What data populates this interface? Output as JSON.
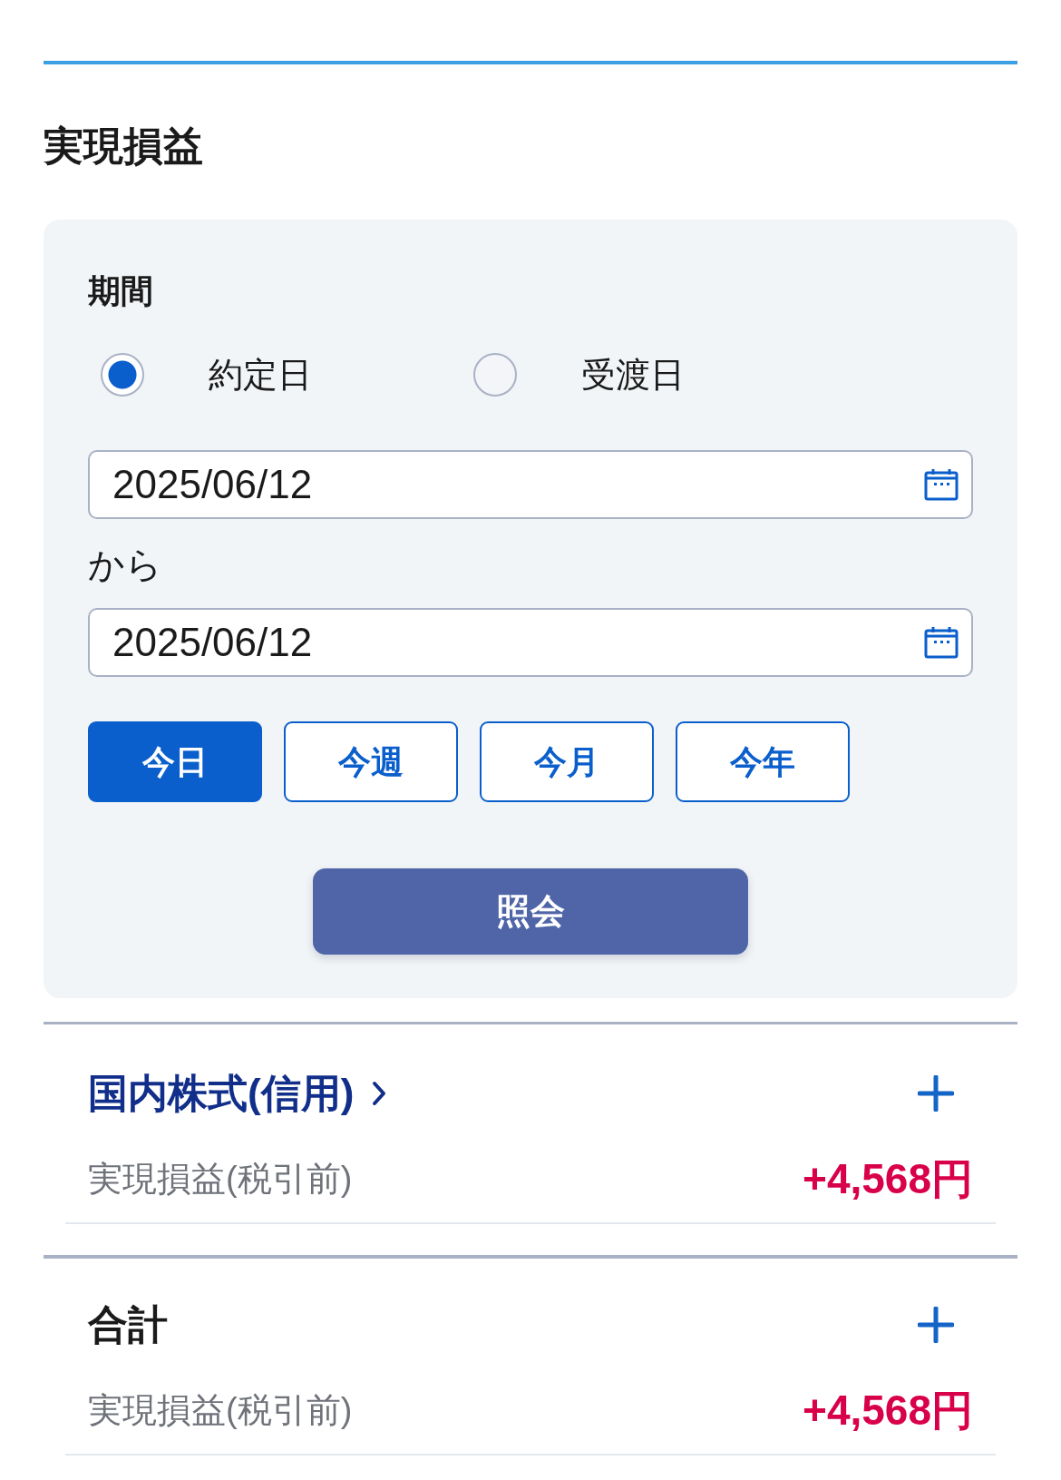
{
  "page": {
    "title": "実現損益"
  },
  "filter": {
    "label": "期間",
    "date_basis": [
      {
        "label": "約定日",
        "selected": true
      },
      {
        "label": "受渡日",
        "selected": false
      }
    ],
    "date_from": {
      "value": "2025/06/12"
    },
    "range_word": "から",
    "date_to": {
      "value": "2025/06/12"
    },
    "presets": [
      {
        "label": "今日",
        "selected": true
      },
      {
        "label": "今週",
        "selected": false
      },
      {
        "label": "今月",
        "selected": false
      },
      {
        "label": "今年",
        "selected": false
      }
    ],
    "submit": "照会"
  },
  "sections": [
    {
      "kind": "link",
      "title": "国内株式(信用)",
      "expanded": false,
      "rows": [
        {
          "label": "実現損益(税引前)",
          "value": "+4,568円"
        }
      ]
    },
    {
      "kind": "total",
      "title": "合計",
      "expanded": false,
      "rows": [
        {
          "label": "実現損益(税引前)",
          "value": "+4,568円"
        }
      ]
    }
  ]
}
